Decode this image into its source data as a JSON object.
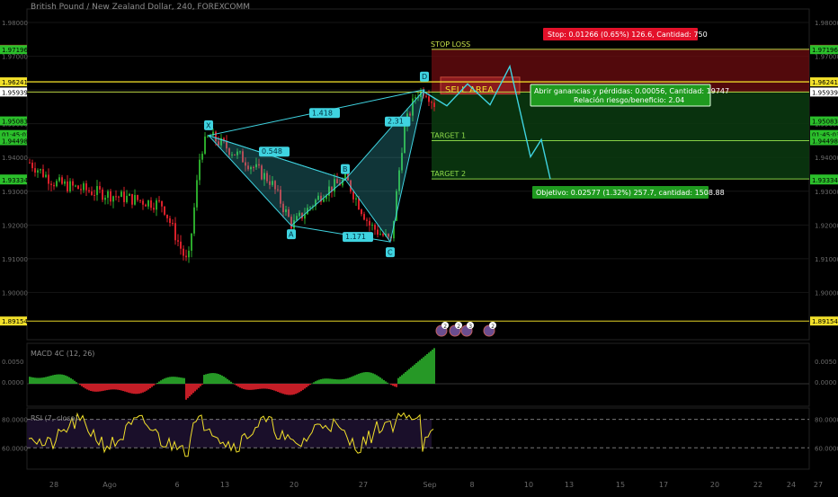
{
  "header": {
    "title": "British Pound / New Zealand Dollar, 240, FOREXCOMM"
  },
  "price_axis": {
    "ticks": [
      "1.98000",
      "1.97000",
      "1.96000",
      "1.95000",
      "1.94000",
      "1.93000",
      "1.92000",
      "1.91000",
      "1.90000"
    ],
    "tick_values": [
      1.98,
      1.97,
      1.96,
      1.95,
      1.94,
      1.93,
      1.92,
      1.91,
      1.9
    ],
    "range": [
      1.886,
      1.984
    ],
    "badges_left": [
      {
        "text": "1.97205",
        "value": 1.97205,
        "color": "#e3112a"
      },
      {
        "text": "1.97196",
        "value": 1.97196,
        "color": "#2bbf2b"
      },
      {
        "text": "1.96241",
        "value": 1.96241,
        "color": "#f2e02a"
      },
      {
        "text": "1.95939",
        "value": 1.95939,
        "color": "#ffffff"
      },
      {
        "text": "1.95083",
        "value": 1.95083,
        "color": "#2bbf2b"
      },
      {
        "text": "01:45:03",
        "value": 1.9468,
        "color": "#2bbf2b"
      },
      {
        "text": "1.94498",
        "value": 1.94498,
        "color": "#2bbf2b"
      },
      {
        "text": "1.93362",
        "value": 1.93362,
        "color": "#2bbf2b"
      },
      {
        "text": "1.93334",
        "value": 1.93334,
        "color": "#2bbf2b"
      },
      {
        "text": "1.89154",
        "value": 1.89154,
        "color": "#f2e02a"
      }
    ],
    "badges_right": [
      {
        "text": "1.97205",
        "value": 1.97205,
        "color": "#e3112a"
      },
      {
        "text": "1.97196",
        "value": 1.97196,
        "color": "#2bbf2b"
      },
      {
        "text": "1.96241",
        "value": 1.96241,
        "color": "#f2e02a"
      },
      {
        "text": "1.95939",
        "value": 1.95939,
        "color": "#ffffff"
      },
      {
        "text": "1.95083",
        "value": 1.95083,
        "color": "#2bbf2b"
      },
      {
        "text": "01:45:03",
        "value": 1.9468,
        "color": "#2bbf2b"
      },
      {
        "text": "1.94498",
        "value": 1.94498,
        "color": "#2bbf2b"
      },
      {
        "text": "1.93362",
        "value": 1.93362,
        "color": "#2bbf2b"
      },
      {
        "text": "1.93334",
        "value": 1.93334,
        "color": "#2bbf2b"
      },
      {
        "text": "1.89154",
        "value": 1.89154,
        "color": "#f2e02a"
      }
    ]
  },
  "time_axis": {
    "labels": [
      "28",
      "Ago",
      "6",
      "13",
      "20",
      "27",
      "Sep",
      "8",
      "10",
      "13",
      "15",
      "17",
      "20",
      "22",
      "24",
      "27"
    ]
  },
  "chart_data": {
    "type": "candlestick",
    "title": "British Pound / New Zealand Dollar, 240, FOREXCOMM",
    "ylim": [
      1.886,
      1.984
    ],
    "levels": [
      {
        "label": "STOP LOSS",
        "value": 1.97205,
        "color": "#c9e34a"
      },
      {
        "label": "SELL AREA",
        "value": 1.96241,
        "color": "#f2e02a"
      },
      {
        "label": "",
        "value": 1.95939,
        "color": "#c9e34a"
      },
      {
        "label": "TARGET 1",
        "value": 1.94498,
        "color": "#8fdc4a"
      },
      {
        "label": "TARGET 2",
        "value": 1.93362,
        "color": "#8fdc4a"
      },
      {
        "label": "",
        "value": 1.89154,
        "color": "#f2e02a"
      }
    ],
    "pattern_points": [
      {
        "label": "X",
        "value": 1.9465
      },
      {
        "label": "A",
        "value": 1.9198
      },
      {
        "label": "B",
        "value": 1.9335
      },
      {
        "label": "C",
        "value": 1.915
      },
      {
        "label": "D",
        "value": 1.9601
      }
    ],
    "ratios": [
      "1.418",
      "0.548",
      "2.31",
      "1.171"
    ],
    "risk_box": {
      "stop": "Stop: 0.01266 (0.65%) 126.6, Cantidad: 750",
      "entry": "Abrir ganancias y pérdidas: 0.00056, Cantidad: 19747",
      "ratio": "Relación riesgo/beneficio: 2.04",
      "target": "Objetivo: 0.02577 (1.32%) 257.7, cantidad: 1508.88"
    },
    "projection": [
      1.9594,
      1.9553,
      1.9618,
      1.9556,
      1.967,
      1.9402,
      1.9453,
      1.9336
    ]
  },
  "events": [
    "2",
    "2",
    "3",
    "2"
  ],
  "macd": {
    "label": "MACD 4C (12, 26)",
    "ticks": [
      "0.0050",
      "0.0000"
    ]
  },
  "rsi": {
    "label": "RSI (7, close)",
    "ticks": [
      "80.0000",
      "60.0000"
    ]
  },
  "colors": {
    "candle_up": "#2ba82b",
    "candle_down": "#d8202a",
    "pattern": "#3fd3e0",
    "rsi_line": "#f2e02a",
    "sell_zone": "#6e0c10",
    "profit_zone": "#0b3b10"
  }
}
